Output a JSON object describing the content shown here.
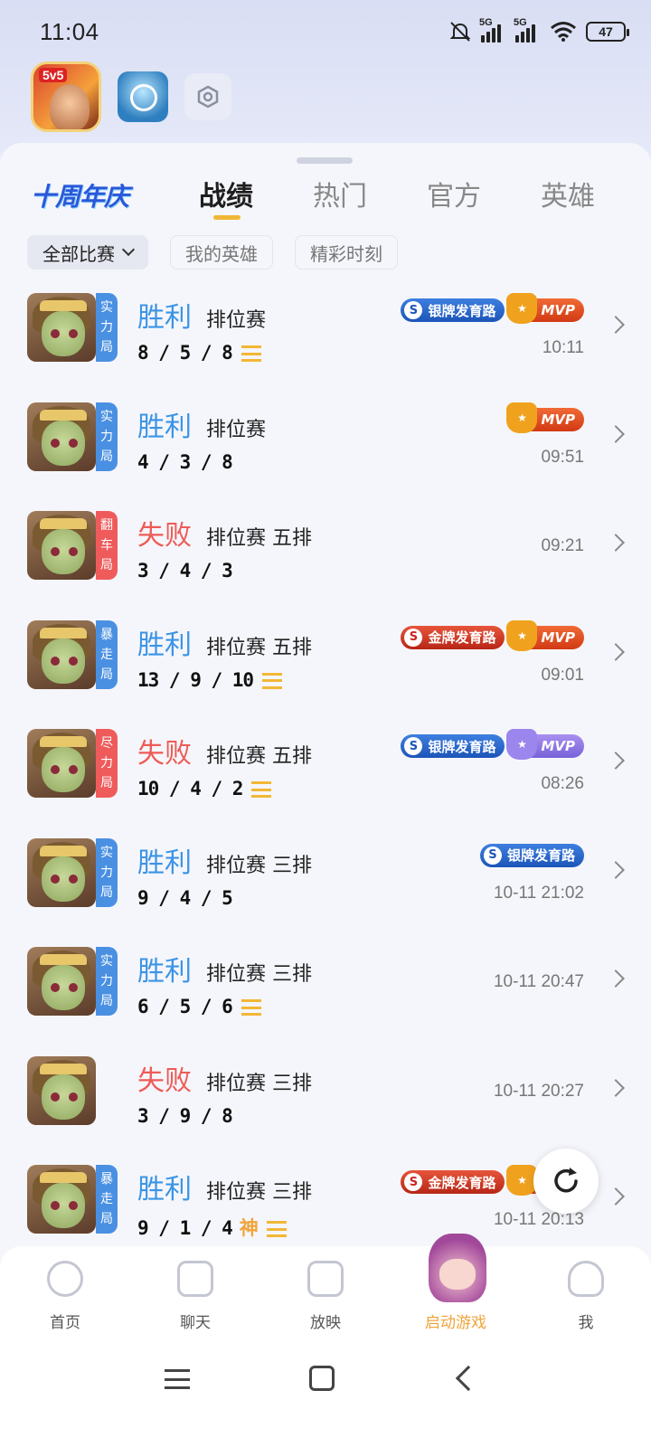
{
  "status_bar": {
    "time": "11:04",
    "signal1": "5G",
    "signal2": "5G",
    "battery": "47"
  },
  "apps": {
    "main_badge": "5v5"
  },
  "header": {
    "logo": "十周年庆",
    "tabs": [
      "战绩",
      "热门",
      "官方",
      "英雄"
    ],
    "active_tab": 0
  },
  "filters": {
    "all_matches": "全部比赛",
    "my_heroes": "我的英雄",
    "highlights": "精彩时刻"
  },
  "matches": [
    {
      "tier": [
        "实",
        "力",
        "局"
      ],
      "tier_color": "blue",
      "result": "胜利",
      "result_type": "win",
      "mode": "排位赛",
      "kda": "8 / 5 / 8",
      "badges": [
        "银牌发育路",
        "MVP"
      ],
      "time": "10:11",
      "menu": true
    },
    {
      "tier": [
        "实",
        "力",
        "局"
      ],
      "tier_color": "blue",
      "result": "胜利",
      "result_type": "win",
      "mode": "排位赛",
      "kda": "4 / 3 / 8",
      "badges": [
        "MVP"
      ],
      "time": "09:51",
      "menu": false
    },
    {
      "tier": [
        "翻",
        "车",
        "局"
      ],
      "tier_color": "red",
      "result": "失败",
      "result_type": "loss",
      "mode": "排位赛 五排",
      "kda": "3 / 4 / 3",
      "badges": [],
      "time": "09:21",
      "menu": false
    },
    {
      "tier": [
        "暴",
        "走",
        "局"
      ],
      "tier_color": "blue",
      "result": "胜利",
      "result_type": "win",
      "mode": "排位赛 五排",
      "kda": "13 / 9 / 10",
      "badges": [
        "金牌发育路",
        "MVP"
      ],
      "time": "09:01",
      "menu": true
    },
    {
      "tier": [
        "尽",
        "力",
        "局"
      ],
      "tier_color": "red",
      "result": "失败",
      "result_type": "loss",
      "mode": "排位赛 五排",
      "kda": "10 / 4 / 2",
      "badges": [
        "银牌发育路",
        "MVP"
      ],
      "time": "08:26",
      "menu": true
    },
    {
      "tier": [
        "实",
        "力",
        "局"
      ],
      "tier_color": "blue",
      "result": "胜利",
      "result_type": "win",
      "mode": "排位赛 三排",
      "kda": "9 / 4 / 5",
      "badges": [
        "银牌发育路"
      ],
      "time": "10-11 21:02",
      "menu": false
    },
    {
      "tier": [
        "实",
        "力",
        "局"
      ],
      "tier_color": "blue",
      "result": "胜利",
      "result_type": "win",
      "mode": "排位赛 三排",
      "kda": "6 / 5 / 6",
      "badges": [],
      "time": "10-11 20:47",
      "menu": true
    },
    {
      "tier": [],
      "tier_color": "",
      "result": "失败",
      "result_type": "loss",
      "mode": "排位赛 三排",
      "kda": "3 / 9 / 8",
      "badges": [],
      "time": "10-11 20:27",
      "menu": false
    },
    {
      "tier": [
        "暴",
        "走",
        "局"
      ],
      "tier_color": "blue",
      "result": "胜利",
      "result_type": "win",
      "mode": "排位赛 三排",
      "kda": "9 / 1 / 4",
      "god": "神",
      "badges": [
        "金牌发育路",
        "MVP"
      ],
      "time": "10-11 20:13",
      "menu": true
    }
  ],
  "bottom_nav": [
    {
      "label": "首页",
      "icon": "compass-icon"
    },
    {
      "label": "聊天",
      "icon": "chat-icon"
    },
    {
      "label": "放映",
      "icon": "tv-icon"
    },
    {
      "label": "启动游戏",
      "icon": "game-avatar-icon"
    },
    {
      "label": "我",
      "icon": "user-icon"
    }
  ],
  "colors": {
    "win": "#3b94e6",
    "loss": "#ee5b56",
    "accent": "#f2b736"
  }
}
